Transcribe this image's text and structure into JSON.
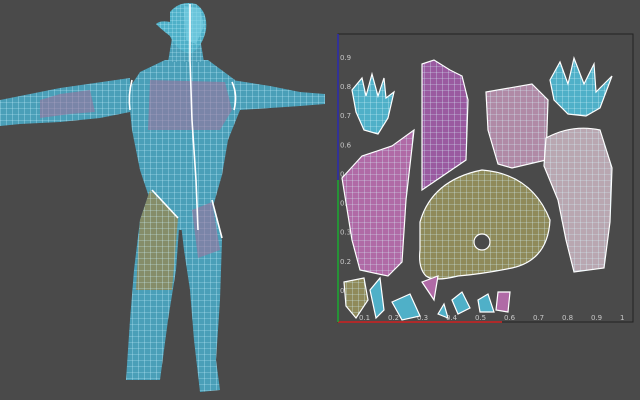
{
  "colors": {
    "background": "#4a4a4a",
    "mesh_base": "#4a9fb8",
    "wire": "#bff1ff",
    "seam": "#ffffff",
    "island_purple": "#b06aa6",
    "island_olive": "#8f8a5a",
    "island_teal": "#4fb0c8",
    "uv_axis_red": "#d02020",
    "uv_axis_green": "#20b020",
    "uv_axis_blue": "#2a2ab0"
  },
  "uv_editor": {
    "x_ticks": [
      "0",
      "0.1",
      "0.2",
      "0.3",
      "0.4",
      "0.5",
      "0.6",
      "0.7",
      "0.8",
      "0.9",
      "1"
    ],
    "y_ticks": [
      "0",
      "0.1",
      "0.2",
      "0.3",
      "0.4",
      "0.5",
      "0.6",
      "0.7",
      "0.8",
      "0.9"
    ]
  },
  "viewport": {
    "model": "humanoid-character-mesh"
  }
}
